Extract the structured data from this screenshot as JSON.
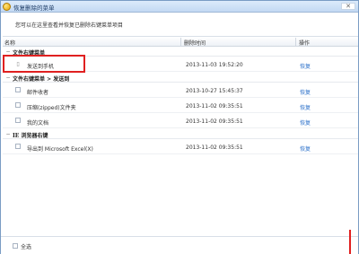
{
  "window": {
    "title": "恢复删除的菜单",
    "close_symbol": "✕"
  },
  "description": "您可以在这里查看并恢复已删除右键菜单项目",
  "columns": {
    "name": "名称",
    "time": "删除时间",
    "action": "操作"
  },
  "groups": [
    {
      "label": "文件右键菜单",
      "toggle_icon": "−",
      "items": [
        {
          "name": "发送到手机",
          "time": "2013-11-03 19:52:20",
          "action": "恢复"
        }
      ]
    },
    {
      "label": "文件右键菜单 > 发送到",
      "toggle_icon": "−",
      "items": [
        {
          "name": "邮件收者",
          "time": "2013-10-27 15:45:37",
          "action": "恢复"
        },
        {
          "name": "压缩(zipped)文件夹",
          "time": "2013-11-02 09:35:51",
          "action": "恢复"
        },
        {
          "name": "我的文档",
          "time": "2013-11-02 09:35:51",
          "action": "恢复"
        }
      ]
    },
    {
      "label": "IE 浏览器右键",
      "toggle_icon": "−",
      "items": [
        {
          "name": "导出到 Microsoft Excel(X)",
          "time": "2013-11-02 09:35:51",
          "action": "恢复"
        }
      ]
    }
  ],
  "footer": {
    "select_all_label": "全选"
  },
  "colors": {
    "highlight": "#e02020",
    "link": "#2a6fc9"
  }
}
